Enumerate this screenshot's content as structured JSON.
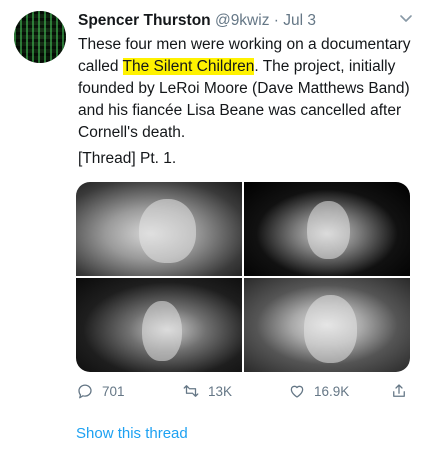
{
  "author": {
    "name": "Spencer Thurston",
    "handle": "@9kwiz",
    "separator": "·",
    "date": "Jul 3"
  },
  "tweet": {
    "text_before": "These four men were working on a documentary called ",
    "highlight": "The Silent Children",
    "text_after": ". The project, initially founded by LeRoi Moore (Dave Matthews Band) and his fiancée Lisa Beane was cancelled after Cornell's death.",
    "thread_marker": "[Thread] Pt. 1."
  },
  "actions": {
    "replies": "701",
    "retweets": "13K",
    "likes": "16.9K"
  },
  "show_thread_label": "Show this thread",
  "colors": {
    "link": "#1da1f2",
    "secondary_text": "#657786",
    "highlight": "#fff200"
  }
}
